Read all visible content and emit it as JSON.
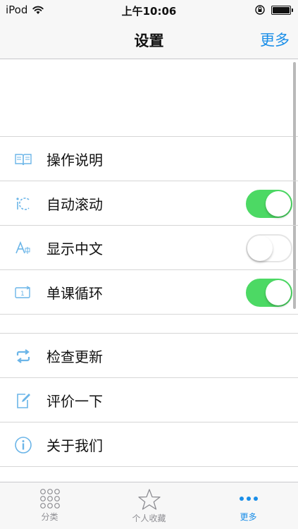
{
  "status_bar": {
    "carrier": "iPod",
    "time": "上午10:06"
  },
  "nav": {
    "title": "设置",
    "action": "更多"
  },
  "settings": {
    "group1": [
      {
        "label": "操作说明",
        "icon": "book-icon"
      },
      {
        "label": "自动滚动",
        "icon": "auto-scroll-icon",
        "toggle": true
      },
      {
        "label": "显示中文",
        "icon": "show-chinese-icon",
        "toggle": false
      },
      {
        "label": "单课循环",
        "icon": "loop-icon",
        "toggle": true
      }
    ],
    "group2": [
      {
        "label": "检查更新",
        "icon": "refresh-icon"
      },
      {
        "label": "评价一下",
        "icon": "edit-icon"
      },
      {
        "label": "关于我们",
        "icon": "info-icon"
      }
    ]
  },
  "tabs": [
    {
      "label": "分类",
      "icon": "grid-icon",
      "active": false
    },
    {
      "label": "个人收藏",
      "icon": "star-icon",
      "active": false
    },
    {
      "label": "更多",
      "icon": "more-icon",
      "active": true
    }
  ],
  "colors": {
    "accent": "#1a8ee8",
    "toggle_on": "#4cd964",
    "icon": "#6bb5e8"
  }
}
